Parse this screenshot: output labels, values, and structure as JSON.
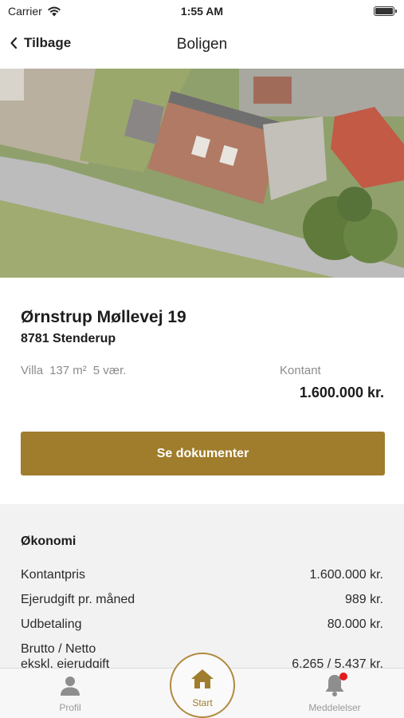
{
  "status_bar": {
    "carrier": "Carrier",
    "time": "1:55 AM"
  },
  "nav": {
    "back_label": "Tilbage",
    "title": "Boligen"
  },
  "property": {
    "address": "Ørnstrup Møllevej 19",
    "city": "8781 Stenderup",
    "type": "Villa",
    "area": "137 m²",
    "rooms": "5 vær.",
    "price_label": "Kontant",
    "price_value": "1.600.000 kr.",
    "docs_button": "Se dokumenter"
  },
  "economy": {
    "heading": "Økonomi",
    "rows": [
      {
        "label": "Kontantpris",
        "value": "1.600.000 kr."
      },
      {
        "label": "Ejerudgift pr. måned",
        "value": "989 kr."
      },
      {
        "label": "Udbetaling",
        "value": "80.000 kr."
      },
      {
        "label": "Brutto / Netto",
        "value": ""
      },
      {
        "label": "ekskl. ejerudgift",
        "value": "6.265 / 5.437 kr."
      }
    ]
  },
  "tabs": {
    "profile": "Profil",
    "start": "Start",
    "messages": "Meddelelser"
  },
  "colors": {
    "accent": "#a07d2c",
    "notification": "#e31b1b"
  },
  "icons": {
    "back": "chevron-left-icon",
    "wifi": "wifi-icon",
    "battery": "battery-icon",
    "profile": "person-icon",
    "start": "home-icon",
    "messages": "bell-icon"
  }
}
